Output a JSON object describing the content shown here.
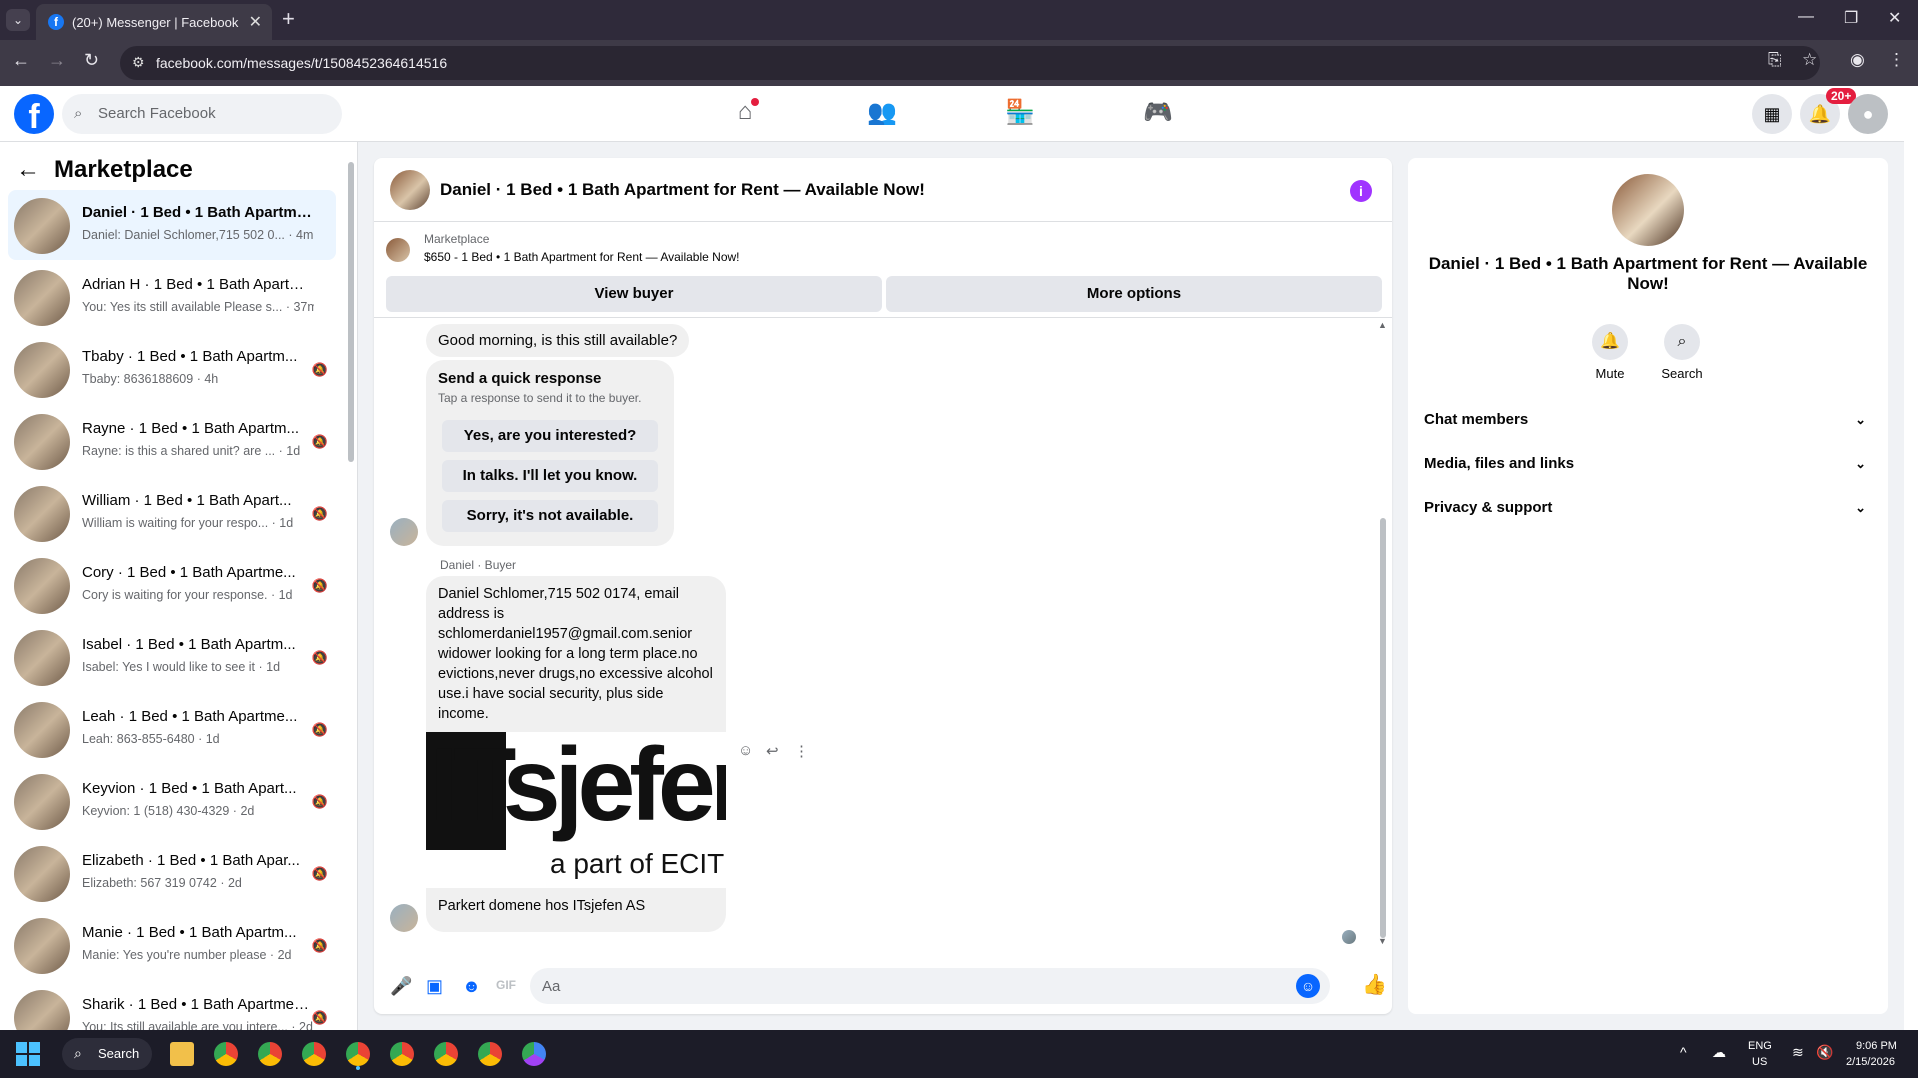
{
  "browser": {
    "tab_title": "(20+) Messenger | Facebook",
    "url": "facebook.com/messages/t/1508452364614516",
    "favicon": "f"
  },
  "fb": {
    "search_placeholder": "Search Facebook",
    "notif_badge": "20+",
    "nav_icons": [
      "home-icon",
      "friends-icon",
      "marketplace-icon",
      "gaming-icon"
    ]
  },
  "sidebar": {
    "title": "Marketplace",
    "conversations": [
      {
        "name": "Daniel · 1 Bed • 1 Bath Apartmen...",
        "preview": "Daniel: Daniel Schlomer,715 502 0...",
        "time": "4m"
      },
      {
        "name": "Adrian H · 1 Bed • 1 Bath Apartm...",
        "preview": "You: Yes its still available Please s...",
        "time": "37m"
      },
      {
        "name": "Tbaby · 1 Bed • 1 Bath Apartm...",
        "preview": "Tbaby: 8636188609",
        "time": "4h"
      },
      {
        "name": "Rayne · 1 Bed • 1 Bath Apartm...",
        "preview": "Rayne: is this a shared unit? are ...",
        "time": "1d"
      },
      {
        "name": "William · 1 Bed • 1 Bath Apart...",
        "preview": "William is waiting for your respo...",
        "time": "1d"
      },
      {
        "name": "Cory · 1 Bed • 1 Bath Apartme...",
        "preview": "Cory is waiting for your response.",
        "time": "1d"
      },
      {
        "name": "Isabel · 1 Bed • 1 Bath Apartm...",
        "preview": "Isabel: Yes I would like to see it",
        "time": "1d"
      },
      {
        "name": "Leah · 1 Bed • 1 Bath Apartme...",
        "preview": "Leah: 863-855-6480",
        "time": "1d"
      },
      {
        "name": "Keyvion · 1 Bed • 1 Bath Apart...",
        "preview": "Keyvion: 1 (518) 430-4329",
        "time": "2d"
      },
      {
        "name": "Elizabeth · 1 Bed • 1 Bath Apar...",
        "preview": "Elizabeth: 567 319 0742",
        "time": "2d"
      },
      {
        "name": "Manie · 1 Bed • 1 Bath Apartm...",
        "preview": "Manie: Yes you're number please",
        "time": "2d"
      },
      {
        "name": "Sharik · 1 Bed • 1 Bath Apartmen...",
        "preview": "You: Its still available are you intere...",
        "time": "2d"
      }
    ]
  },
  "chat": {
    "title": "Daniel · 1 Bed • 1 Bath Apartment for Rent — Available Now!",
    "listing_source": "Marketplace",
    "listing_title": "$650 - 1 Bed • 1 Bath Apartment for Rent — Available Now!",
    "view_buyer": "View buyer",
    "more_options": "More options",
    "msg1": "Good morning, is this still available?",
    "quick_title": "Send a quick response",
    "quick_sub": "Tap a response to send it to the buyer.",
    "quick_responses": [
      "Yes, are you interested?",
      "In talks. I'll let you know.",
      "Sorry, it's not available."
    ],
    "sender_label": "Daniel · Buyer",
    "msg2": "Daniel Schlomer,715 502 0174, email address is schlomerdaniel1957@gmail.com.senior widower looking for a long term place.no evictions,never drugs,no excessive alcohol use.i have social security, plus side income.",
    "link_logo_main": "ITsjefer",
    "link_logo_sub": "a part of ECIT",
    "link_caption": "Parkert domene hos ITsjefen AS",
    "composer_placeholder": "Aa"
  },
  "right_panel": {
    "title": "Daniel · 1 Bed • 1 Bath Apartment for Rent — Available Now!",
    "mute": "Mute",
    "search": "Search",
    "sections": [
      "Chat members",
      "Media, files and links",
      "Privacy & support"
    ]
  },
  "taskbar": {
    "search": "Search",
    "lang1": "ENG",
    "lang2": "US",
    "time": "9:06 PM",
    "date": "2/15/2026"
  },
  "colors": {
    "fb_blue": "#0866ff",
    "badge_red": "#e41e3f",
    "info_purple": "#a033ff"
  }
}
